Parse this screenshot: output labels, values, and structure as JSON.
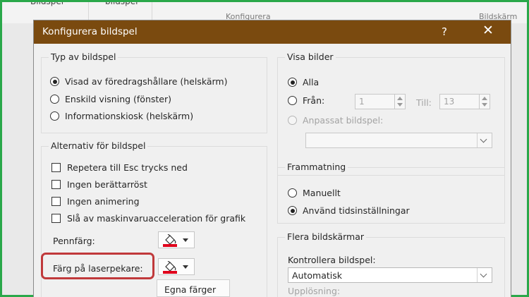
{
  "ribbon": {
    "tabs": [
      "Bildspel",
      "bildspel"
    ],
    "group_labels": [
      "Konfigurera",
      "Bildskärm"
    ]
  },
  "dialog": {
    "title": "Konfigurera bildspel",
    "help_glyph": "?",
    "close_glyph": "✕",
    "title_bar_color": "#7a4a0f"
  },
  "slideshow_type": {
    "label": "Typ av bildspel",
    "options": [
      {
        "label": "Visad av föredragshållare (helskärm)",
        "selected": true
      },
      {
        "label": "Enskild visning (fönster)",
        "selected": false
      },
      {
        "label": "Informationskiosk (helskärm)",
        "selected": false
      }
    ]
  },
  "show_options": {
    "label": "Alternativ för bildspel",
    "checkboxes": [
      {
        "label": "Repetera till Esc trycks ned",
        "checked": false
      },
      {
        "label": "Ingen berättarröst",
        "checked": false
      },
      {
        "label": "Ingen animering",
        "checked": false
      },
      {
        "label": "Slå av maskinvaruacceleration för grafik",
        "checked": false
      }
    ],
    "pen_color_label": "Pennfärg:",
    "laser_color_label": "Färg på laserpekare:",
    "pen_color": "#e0001b",
    "laser_color": "#e0001b"
  },
  "show_slides": {
    "label": "Visa bilder",
    "all_label": "Alla",
    "from_label": "Från:",
    "from_value": "1",
    "to_label": "Till:",
    "to_value": "13",
    "custom_label": "Anpassat bildspel:",
    "custom_value": ""
  },
  "advance": {
    "label": "Frammatning",
    "manual_label": "Manuellt",
    "timings_label": "Använd tidsinställningar"
  },
  "monitors": {
    "label": "Flera bildskärmar",
    "control_label": "Kontrollera bildspel:",
    "control_value": "Automatisk",
    "resolution_label": "Upplösning:"
  },
  "color_popup": {
    "label": "Egna färger"
  },
  "highlight_color": "#c0393b"
}
